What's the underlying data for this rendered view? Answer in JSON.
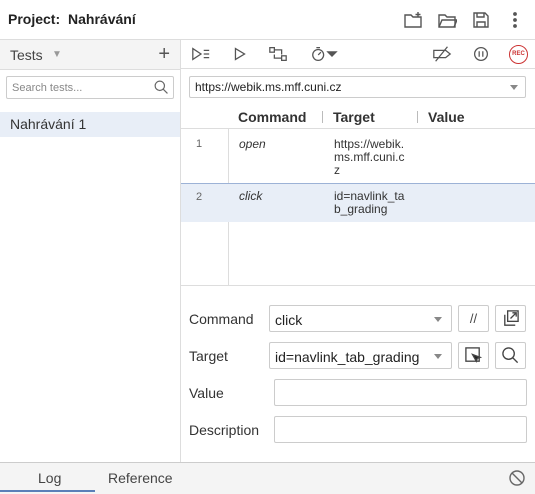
{
  "header": {
    "project_label": "Project:",
    "project_name": "Nahrávání",
    "icons": [
      "new-project-icon",
      "open-project-icon",
      "save-project-icon",
      "more-icon"
    ]
  },
  "tests": {
    "title": "Tests",
    "search_placeholder": "Search tests...",
    "items": [
      {
        "label": "Nahrávání 1"
      }
    ]
  },
  "toolbar": {
    "icons": [
      "run-all-icon",
      "run-test-icon",
      "step-icon",
      "speed-icon",
      "disable-breakpoints-icon",
      "pause-icon"
    ],
    "rec_label": "REC"
  },
  "url": {
    "value": "https://webik.ms.mff.cuni.cz"
  },
  "table": {
    "headers": [
      "Command",
      "Target",
      "Value"
    ],
    "rows": [
      {
        "num": "1",
        "command": "open",
        "target": "https://webik.ms.mff.cuni.cz",
        "value": ""
      },
      {
        "num": "2",
        "command": "click",
        "target": "id=navlink_tab_grading",
        "value": ""
      }
    ]
  },
  "editor": {
    "command_label": "Command",
    "command_value": "click",
    "comment_btn": "//",
    "target_label": "Target",
    "target_value": "id=navlink_tab_grading",
    "value_label": "Value",
    "value_value": "",
    "description_label": "Description",
    "description_value": ""
  },
  "footer": {
    "tabs": [
      "Log",
      "Reference"
    ]
  },
  "colors": {
    "selection": "#e8eef7",
    "rec": "#cc3333",
    "active_tab": "#5a7fb8"
  }
}
